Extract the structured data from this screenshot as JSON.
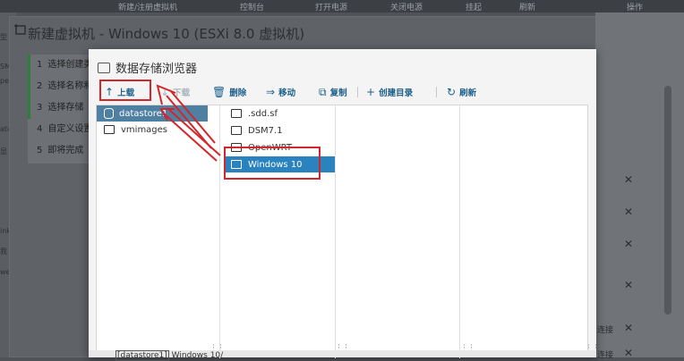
{
  "background": {
    "topbar_items": [
      "新建/注册虚拟机",
      "控制台",
      "打开电源",
      "关闭电源",
      "挂起",
      "刷新",
      "操作"
    ],
    "left_fragments": [
      "型",
      "SM",
      "pe",
      "ata",
      "显",
      "ink",
      "我",
      "we"
    ],
    "right_rows": [
      {
        "label": "",
        "close": "✕"
      },
      {
        "label": "",
        "close": "✕"
      },
      {
        "label": "",
        "close": "✕"
      },
      {
        "label": "",
        "close": "✕"
      },
      {
        "label": "连接",
        "close": "✕"
      },
      {
        "label": "连接",
        "close": "✕"
      }
    ]
  },
  "wizard": {
    "title": "新建虚拟机 - Windows 10 (ESXi 8.0 虚拟机)",
    "steps": [
      {
        "num": "1",
        "label": "选择创建类"
      },
      {
        "num": "2",
        "label": "选择名称和"
      },
      {
        "num": "3",
        "label": "选择存储"
      },
      {
        "num": "4",
        "label": "自定义设置"
      },
      {
        "num": "5",
        "label": "即将完成"
      }
    ]
  },
  "dialog": {
    "title": "数据存储浏览器",
    "toolbar": {
      "upload": "上载",
      "download": "下载",
      "delete": "删除",
      "move": "移动",
      "copy": "复制",
      "create_dir": "创建目录",
      "refresh": "刷新"
    },
    "icons": {
      "upload": "↑",
      "download": "↓",
      "delete": "🗑",
      "move": "⇒",
      "copy": "⧉",
      "create_dir": "+",
      "refresh": "↻"
    },
    "datastores": [
      {
        "name": "datastore1",
        "selected": true
      },
      {
        "name": "vmimages",
        "selected": false
      }
    ],
    "folders": [
      {
        "name": ".sdd.sf",
        "selected": false
      },
      {
        "name": "DSM7.1",
        "selected": false
      },
      {
        "name": "OpenWRT",
        "selected": false
      },
      {
        "name": "Windows 10",
        "selected": true
      }
    ],
    "footer_path_ds": "[datastore1]",
    "footer_path_rest": " Windows 10/"
  },
  "colors": {
    "accent": "#1b5f8a",
    "selected": "#2a83bf",
    "annotation": "#d3262b"
  }
}
